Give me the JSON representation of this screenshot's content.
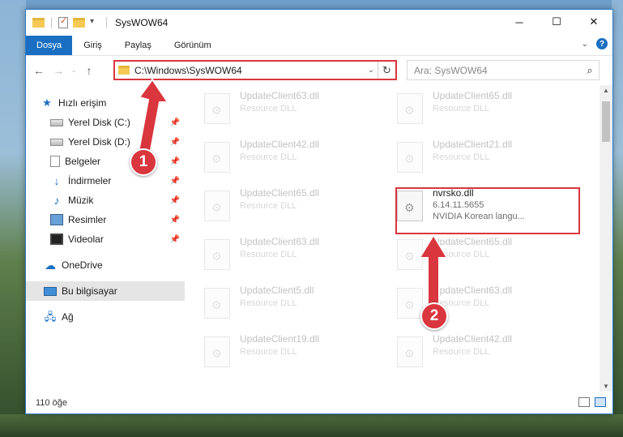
{
  "window": {
    "title": "SysWOW64",
    "controls": {
      "minimize": "─",
      "maximize": "☐",
      "close": "✕"
    }
  },
  "ribbon": {
    "tabs": [
      "Dosya",
      "Giriş",
      "Paylaş",
      "Görünüm"
    ]
  },
  "address": {
    "path": "C:\\Windows\\SysWOW64",
    "search_placeholder": "Ara: SysWOW64"
  },
  "sidebar": {
    "items": [
      {
        "label": "Hızlı erişim",
        "icon": "star-icon",
        "pinned": false
      },
      {
        "label": "Yerel Disk (C:)",
        "icon": "drive-icon",
        "pinned": true
      },
      {
        "label": "Yerel Disk (D:)",
        "icon": "drive-icon",
        "pinned": true
      },
      {
        "label": "Belgeler",
        "icon": "documents-icon",
        "pinned": true
      },
      {
        "label": "İndirmeler",
        "icon": "download-icon",
        "pinned": true
      },
      {
        "label": "Müzik",
        "icon": "music-icon",
        "pinned": true
      },
      {
        "label": "Resimler",
        "icon": "pictures-icon",
        "pinned": true
      },
      {
        "label": "Videolar",
        "icon": "videos-icon",
        "pinned": true
      },
      {
        "label": "OneDrive",
        "icon": "cloud-icon",
        "pinned": false
      },
      {
        "label": "Bu bilgisayar",
        "icon": "computer-icon",
        "pinned": false,
        "selected": true
      },
      {
        "label": "Ağ",
        "icon": "network-icon",
        "pinned": false
      }
    ]
  },
  "files": [
    {
      "name": "UpdateClient63.dll",
      "desc": "Resource DLL",
      "faded": true
    },
    {
      "name": "UpdateClient65.dll",
      "desc": "Resource DLL",
      "faded": true
    },
    {
      "name": "UpdateClient42.dll",
      "desc": "Resource DLL",
      "faded": true
    },
    {
      "name": "UpdateClient21.dll",
      "desc": "Resource DLL",
      "faded": true
    },
    {
      "name": "UpdateClient65.dll",
      "desc": "Resource DLL",
      "faded": true
    },
    {
      "name": "nvrsko.dll",
      "desc": "6.14.11.5655",
      "desc2": "NVIDIA Korean langu...",
      "faded": false,
      "highlighted": true
    },
    {
      "name": "UpdateClient63.dll",
      "desc": "Resource DLL",
      "faded": true
    },
    {
      "name": "UpdateClient65.dll",
      "desc": "Resource DLL",
      "faded": true
    },
    {
      "name": "UpdateClient5.dll",
      "desc": "Resource DLL",
      "faded": true
    },
    {
      "name": "UpdateClient63.dll",
      "desc": "Resource DLL",
      "faded": true
    },
    {
      "name": "UpdateClient19.dll",
      "desc": "Resource DLL",
      "faded": true
    },
    {
      "name": "UpdateClient42.dll",
      "desc": "Resource DLL",
      "faded": true
    }
  ],
  "status": {
    "count": "110 öğe"
  },
  "annotations": {
    "badge1": "1",
    "badge2": "2",
    "color": "#d9363e"
  }
}
